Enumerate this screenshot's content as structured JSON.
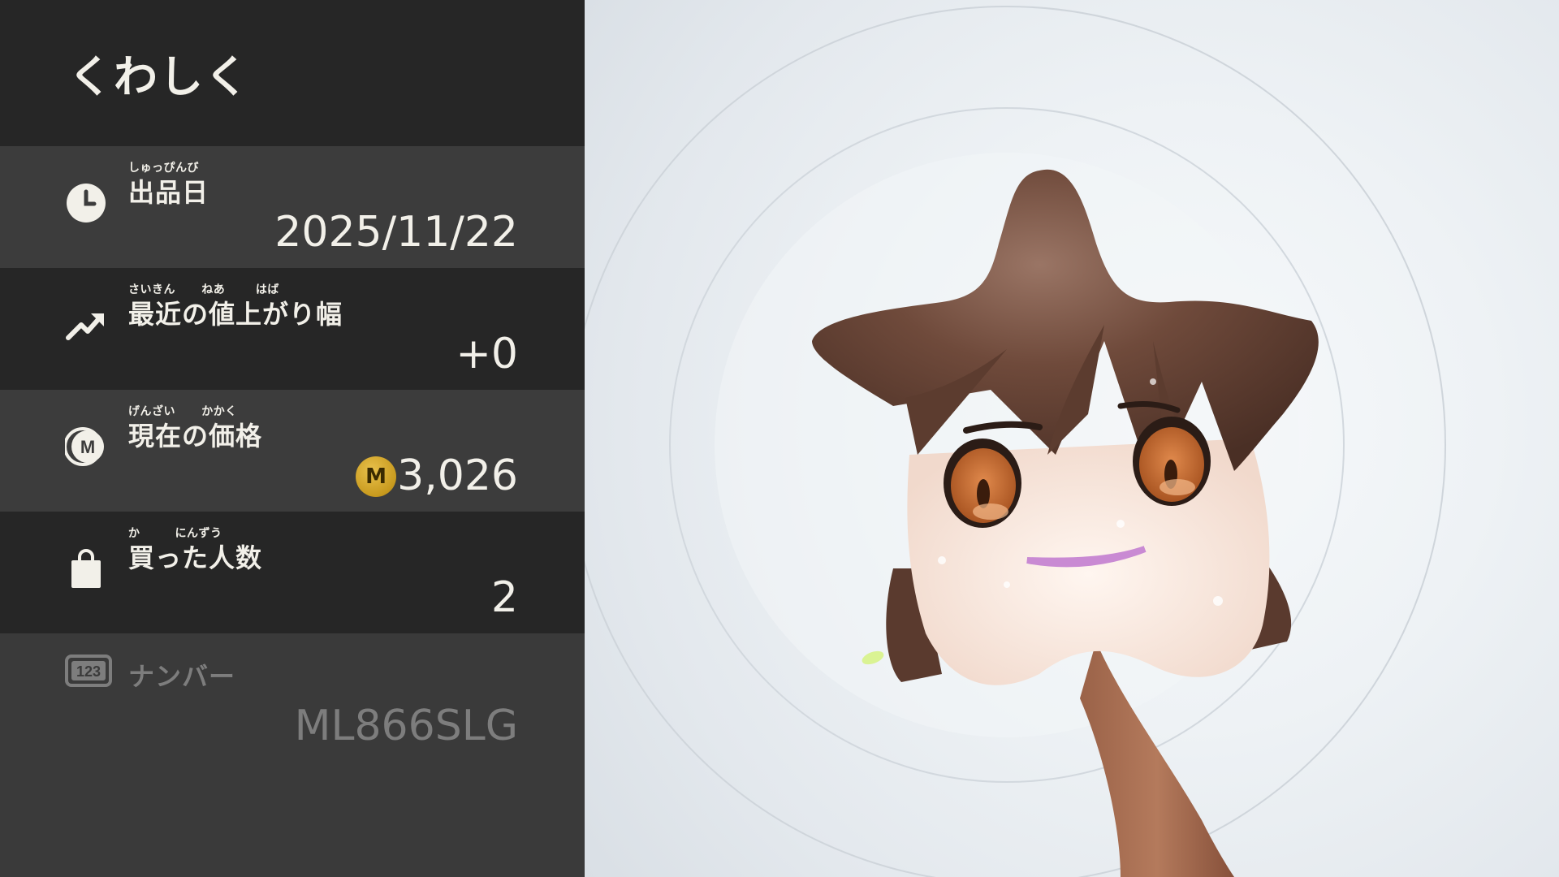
{
  "panel": {
    "title": "くわしく",
    "rows": [
      {
        "ruby": "しゅっぴんび",
        "label": "出品日",
        "value": "2025/11/22",
        "icon": "clock-icon"
      },
      {
        "ruby": "さいきん      ねあ       はば",
        "label": "最近の値上がり幅",
        "value": "+0",
        "icon": "trend-up-icon"
      },
      {
        "ruby": "げんざい      かかく",
        "label": "現在の価格",
        "value": "3,026",
        "coin": "M",
        "icon": "m-coin-icon"
      },
      {
        "ruby": "か        にんずう",
        "label": "買った人数",
        "value": "2",
        "icon": "shopping-bag-icon"
      },
      {
        "label": "ナンバー",
        "value": "ML866SLG",
        "icon_text": "123",
        "icon": "number-badge-icon"
      }
    ]
  },
  "colors": {
    "panel_dark": "#262626",
    "panel_light": "#3c3c3c",
    "text": "#f2f0e9",
    "muted": "#7d7d7d",
    "coin": "#c89a1e"
  },
  "scene": {
    "character": "star-headed-character-icon"
  }
}
